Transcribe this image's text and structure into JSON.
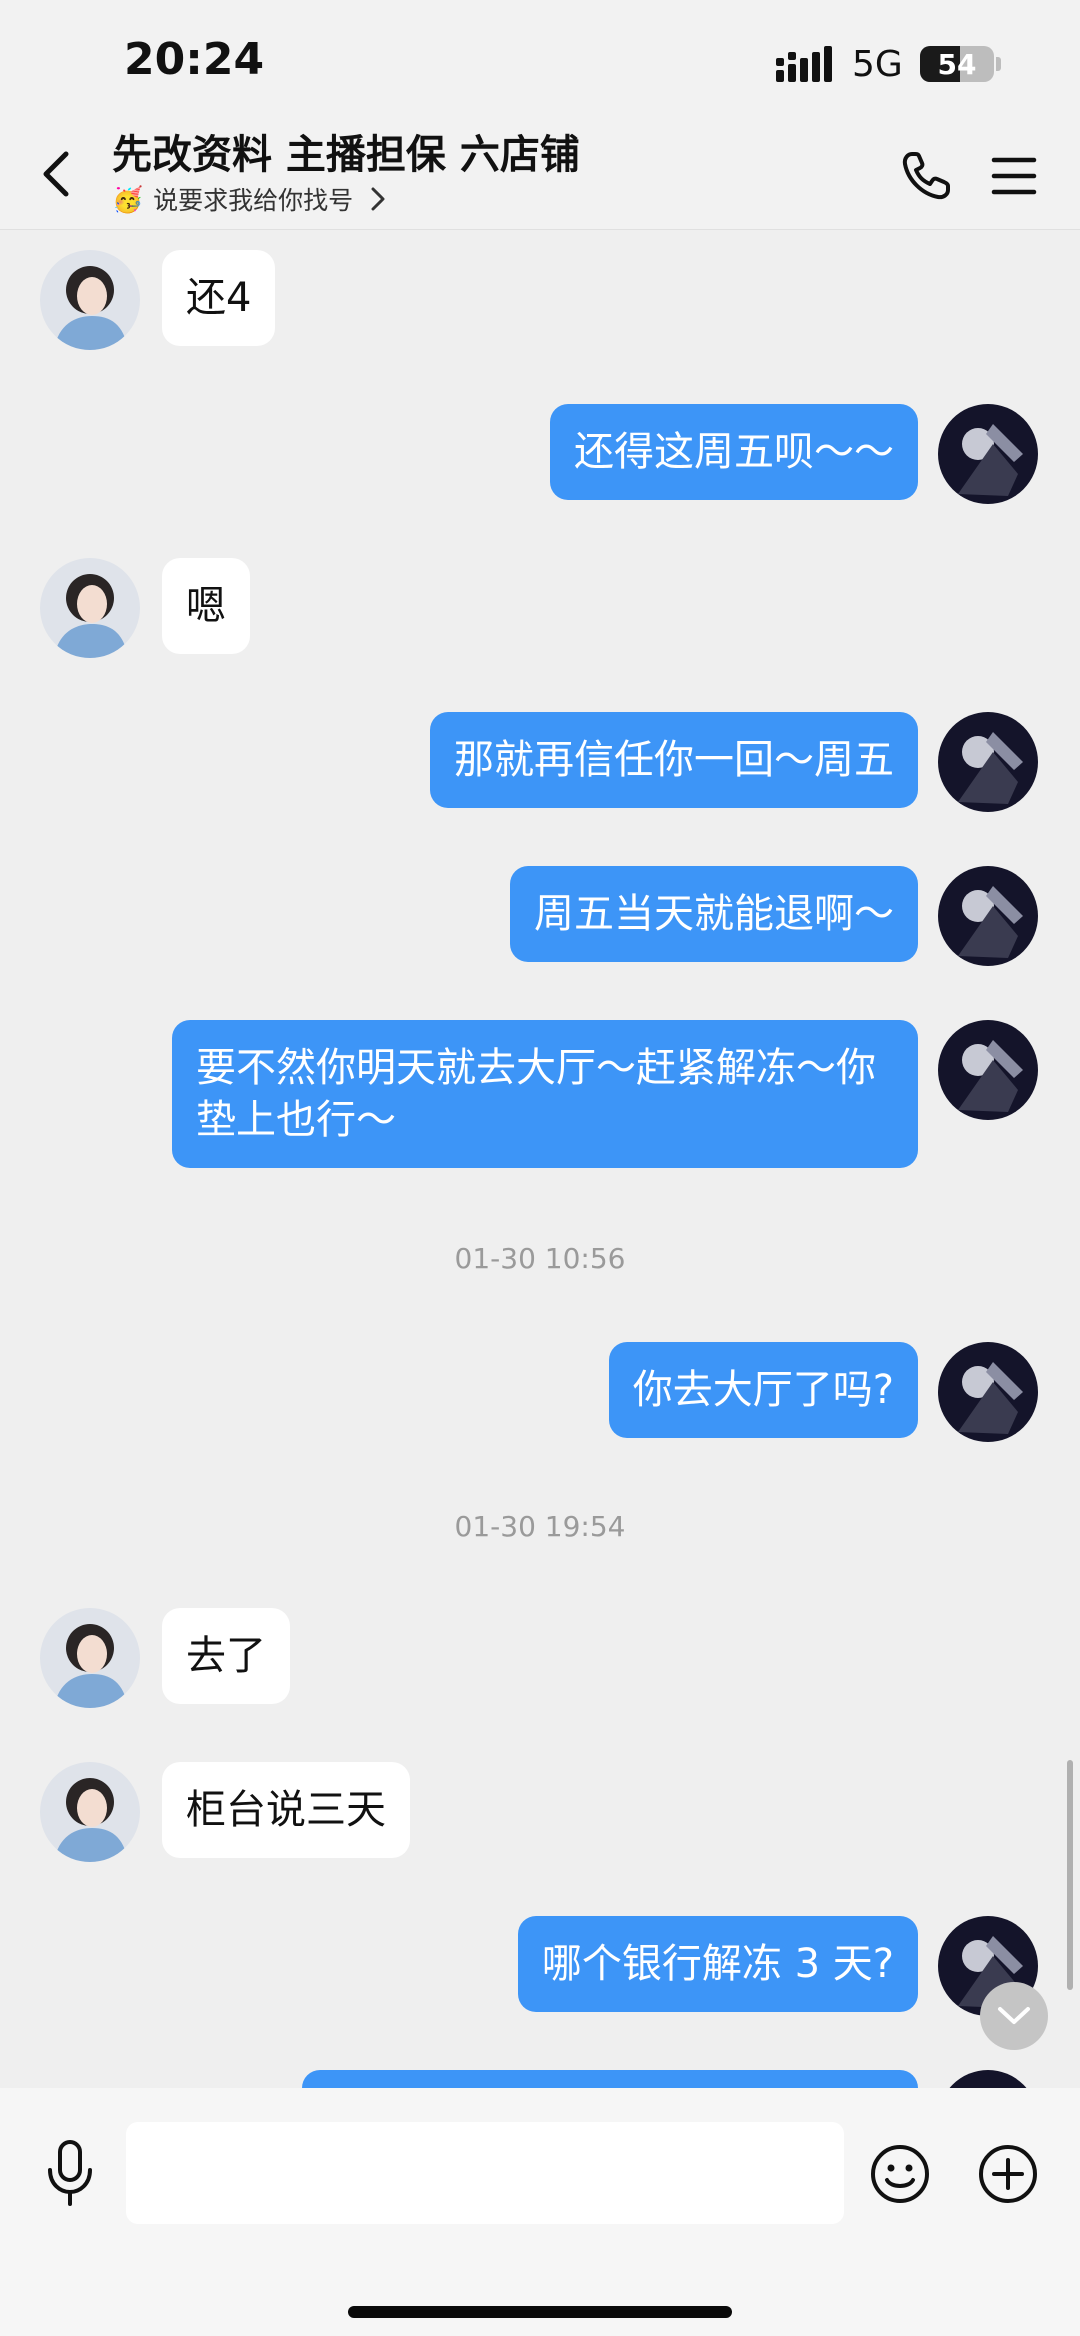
{
  "status_bar": {
    "time": "20:24",
    "network": "5G",
    "battery_level": "54",
    "battery_fraction": 0.54
  },
  "header": {
    "title": "先改资料 主播担保 六店铺",
    "subtitle": "说要求我给你找号",
    "subtitle_emoji": "🥳",
    "icons": {
      "back": "chevron-left-icon",
      "call": "phone-icon",
      "menu": "menu-icon"
    }
  },
  "messages": [
    {
      "side": "in",
      "text": "还4"
    },
    {
      "side": "out",
      "text": "还得这周五呗～～"
    },
    {
      "side": "in",
      "text": "嗯"
    },
    {
      "side": "out",
      "text": "那就再信任你一回～周五"
    },
    {
      "side": "out",
      "text": "周五当天就能退啊～"
    },
    {
      "side": "out",
      "text": "要不然你明天就去大厅～赶紧解冻～你垫上也行～"
    },
    {
      "timestamp": "01-30 10:56"
    },
    {
      "side": "out",
      "text": "你去大厅了吗?"
    },
    {
      "timestamp": "01-30 19:54"
    },
    {
      "side": "in",
      "text": "去了"
    },
    {
      "side": "in",
      "text": "柜台说三天"
    },
    {
      "side": "out",
      "text": "哪个银行解冻 3 天?"
    }
  ],
  "input_bar": {
    "message_placeholder": "",
    "icons": {
      "voice": "microphone-icon",
      "emoji": "smiley-icon",
      "more": "plus-circle-icon"
    }
  },
  "colors": {
    "outgoing_bubble": "#3d95f7",
    "incoming_bubble": "#ffffff",
    "background": "#efefef"
  }
}
